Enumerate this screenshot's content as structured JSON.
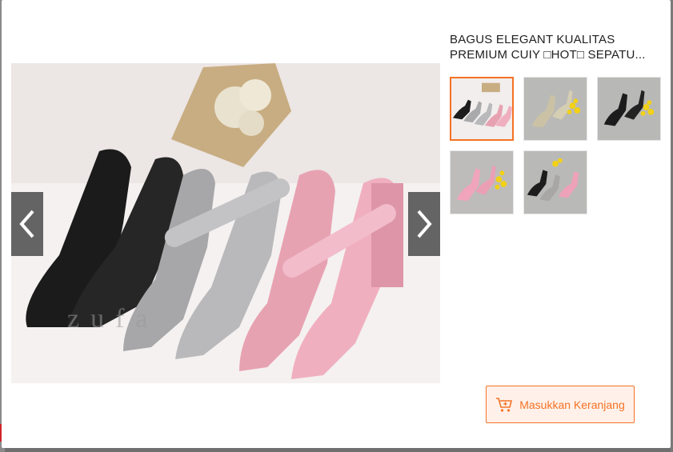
{
  "product": {
    "title_line1": "BAGUS ELEGANT KUALITAS",
    "title_line2": "PREMIUM CUIY □HOT□ SEPATU..."
  },
  "gallery": {
    "prev_icon": "chevron-left-icon",
    "next_icon": "chevron-right-icon",
    "main_image": "shoes-black-grey-pink",
    "watermark": "zufa",
    "thumbnails": [
      {
        "name": "thumb-1",
        "subject": "four shoes black grey pink"
      },
      {
        "name": "thumb-2",
        "subject": "beige shoe with flowers"
      },
      {
        "name": "thumb-3",
        "subject": "black shoe with flowers"
      },
      {
        "name": "thumb-4",
        "subject": "pink shoe with flowers"
      },
      {
        "name": "thumb-5",
        "subject": "black and pink shoes"
      }
    ],
    "active_index": 0
  },
  "actions": {
    "add_to_cart_label": "Masukkan Keranjang",
    "cart_icon": "cart-plus-icon"
  },
  "colors": {
    "accent": "#f57224",
    "accent_bg": "#fff1ea",
    "title_text": "#212121"
  }
}
